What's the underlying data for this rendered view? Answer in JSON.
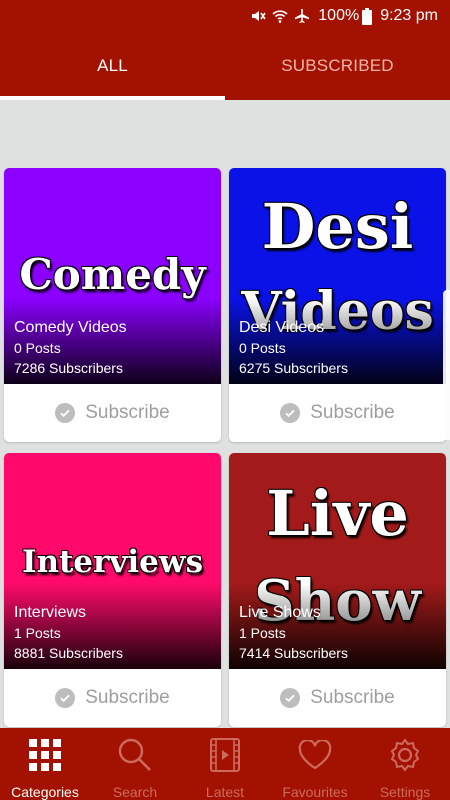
{
  "status_bar": {
    "battery": "100%",
    "time": "9:23 pm",
    "icons": [
      "mute-icon",
      "wifi-icon",
      "airplane-icon",
      "battery-icon"
    ]
  },
  "tabs": [
    {
      "label": "ALL",
      "active": true
    },
    {
      "label": "SUBSCRIBED",
      "active": false
    }
  ],
  "categories": [
    {
      "thumb_text": [
        "Comedy"
      ],
      "title": "Comedy Videos",
      "posts": "0 Posts",
      "subscribers": "7286 Subscribers",
      "subscribe_label": "Subscribe",
      "color": "#8b00ff"
    },
    {
      "thumb_text": [
        "Desi",
        "Videos"
      ],
      "title": "Desi Videos",
      "posts": "0 Posts",
      "subscribers": "6275 Subscribers",
      "subscribe_label": "Subscribe",
      "color": "#0a12e8"
    },
    {
      "thumb_text": [
        "Interviews"
      ],
      "title": "Interviews",
      "posts": "1 Posts",
      "subscribers": "8881 Subscribers",
      "subscribe_label": "Subscribe",
      "color": "#ff0a6a"
    },
    {
      "thumb_text": [
        "Live",
        "Show"
      ],
      "title": "Live Shows",
      "posts": "1 Posts",
      "subscribers": "7414 Subscribers",
      "subscribe_label": "Subscribe",
      "color": "#a31a1a"
    }
  ],
  "bottom_nav": [
    {
      "label": "Categories",
      "icon": "grid-icon",
      "active": true
    },
    {
      "label": "Search",
      "icon": "search-icon",
      "active": false
    },
    {
      "label": "Latest",
      "icon": "film-icon",
      "active": false
    },
    {
      "label": "Favourites",
      "icon": "heart-icon",
      "active": false
    },
    {
      "label": "Settings",
      "icon": "gear-icon",
      "active": false
    }
  ],
  "colors": {
    "primary": "#a31100",
    "background": "#dfe1e1",
    "nav_inactive": "#cd6a5e",
    "subscribe_text": "#9e9e9e"
  }
}
